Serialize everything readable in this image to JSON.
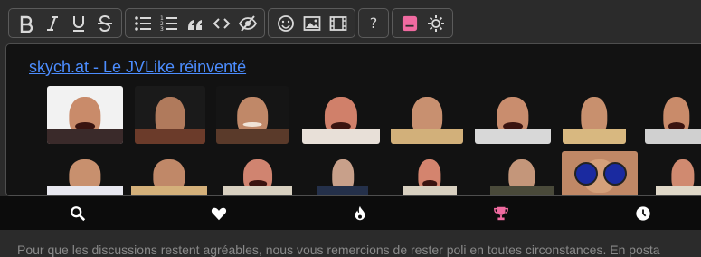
{
  "toolbar": {
    "groups": [
      [
        "bold-icon",
        "italic-icon",
        "underline-icon",
        "strikethrough-icon"
      ],
      [
        "bullet-list-icon",
        "numbered-list-icon",
        "quote-icon",
        "code-icon",
        "hide-icon"
      ],
      [
        "emoji-icon",
        "image-icon",
        "video-icon"
      ],
      [
        "help-icon"
      ],
      [
        "sticker-icon",
        "settings-icon"
      ]
    ],
    "help_label": "?"
  },
  "panel": {
    "link_text": "skych.at - Le JVLike réinventé",
    "stickers_row1": 9,
    "stickers_row2": 9
  },
  "tabs": [
    "search-icon",
    "heart-icon",
    "fire-icon",
    "trophy-icon",
    "clock-icon"
  ],
  "colors": {
    "accent_pink": "#f06aa0",
    "link": "#4c8dff"
  },
  "notice": "Pour que les discussions restent agréables, nous vous remercions de rester poli en toutes circonstances. En posta"
}
